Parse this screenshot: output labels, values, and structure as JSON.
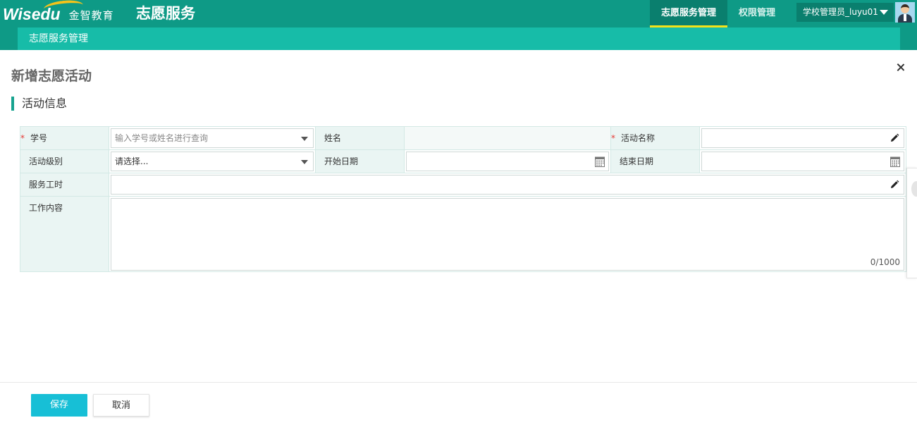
{
  "header": {
    "logo_word": "Wisedu",
    "logo_cn": "金智教育",
    "app_title": "志愿服务",
    "nav": [
      {
        "label": "志愿服务管理",
        "active": true
      },
      {
        "label": "权限管理",
        "active": false
      }
    ],
    "user_name": "学校管理员_luyu01"
  },
  "subbar": {
    "title": "志愿服务管理"
  },
  "page": {
    "title": "新增志愿活动",
    "section_title": "活动信息"
  },
  "form": {
    "student_id": {
      "label": "学号",
      "required": true,
      "placeholder": "输入学号或姓名进行查询"
    },
    "name": {
      "label": "姓名",
      "value": ""
    },
    "activity_name": {
      "label": "活动名称",
      "required": true,
      "value": ""
    },
    "activity_level": {
      "label": "活动级别",
      "placeholder": "请选择..."
    },
    "start_date": {
      "label": "开始日期",
      "value": ""
    },
    "end_date": {
      "label": "结束日期",
      "value": ""
    },
    "service_hours": {
      "label": "服务工时",
      "value": ""
    },
    "work_content": {
      "label": "工作内容",
      "value": "",
      "counter": "0/1000"
    }
  },
  "footer": {
    "save_label": "保存",
    "cancel_label": "取消"
  },
  "colors": {
    "header_bg": "#0e9a86",
    "subbar_bg": "#17bca8",
    "accent": "#17a38f",
    "save_button": "#17bfd6",
    "active_underline": "#f3e21a"
  }
}
